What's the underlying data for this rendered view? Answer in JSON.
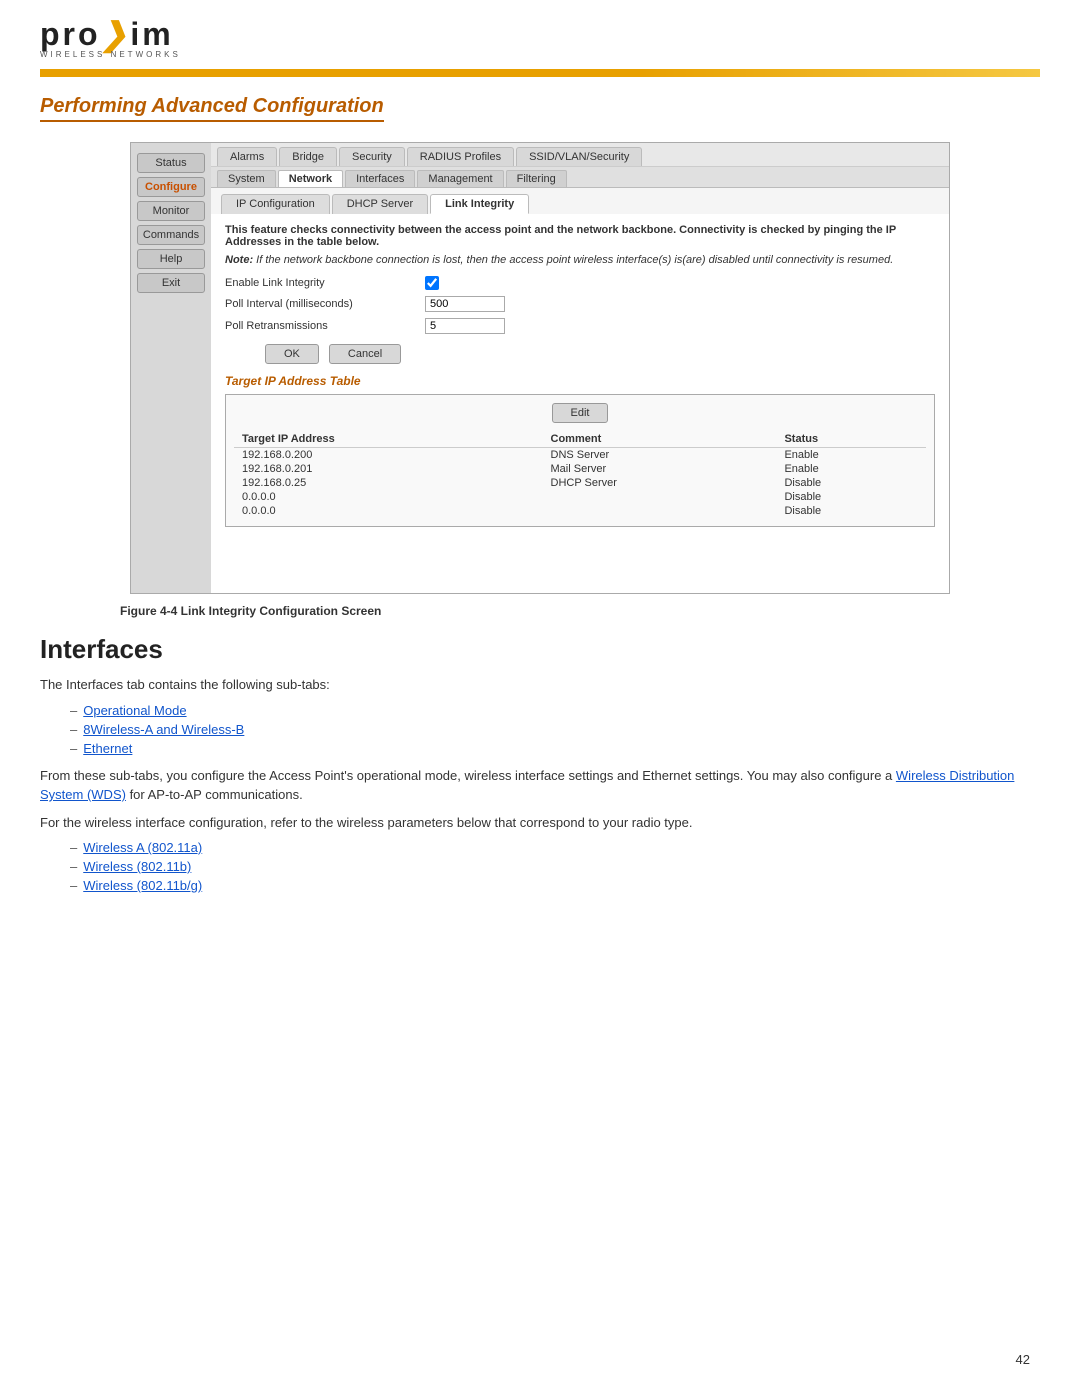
{
  "header": {
    "logo_text_pre": "pro",
    "logo_arrow": "❯",
    "logo_text_post": "im",
    "logo_subtitle": "WIRELESS NETWORKS"
  },
  "page_title": "Performing Advanced Configuration",
  "ui_panel": {
    "sidebar_buttons": [
      {
        "label": "Status",
        "active": false
      },
      {
        "label": "Configure",
        "active": true
      },
      {
        "label": "Monitor",
        "active": false
      },
      {
        "label": "Commands",
        "active": false
      },
      {
        "label": "Help",
        "active": false
      },
      {
        "label": "Exit",
        "active": false
      }
    ],
    "nav_tabs_row1": [
      {
        "label": "Alarms",
        "active": false
      },
      {
        "label": "Bridge",
        "active": false
      },
      {
        "label": "Security",
        "active": false
      },
      {
        "label": "RADIUS Profiles",
        "active": false
      },
      {
        "label": "SSID/VLAN/Security",
        "active": false
      }
    ],
    "nav_tabs_row2": [
      {
        "label": "System",
        "active": false
      },
      {
        "label": "Network",
        "active": true
      },
      {
        "label": "Interfaces",
        "active": false
      },
      {
        "label": "Management",
        "active": false
      },
      {
        "label": "Filtering",
        "active": false
      }
    ],
    "sub_tabs": [
      {
        "label": "IP Configuration",
        "active": false
      },
      {
        "label": "DHCP Server",
        "active": false
      },
      {
        "label": "Link Integrity",
        "active": true
      }
    ],
    "description": "This feature checks connectivity between the access point and the network backbone. Connectivity is checked by pinging the IP Addresses in the table below.",
    "note": "Note: If the network backbone connection is lost, then the access point wireless interface(s) is(are) disabled until connectivity is resumed.",
    "form_fields": [
      {
        "label": "Enable Link Integrity",
        "type": "checkbox",
        "checked": true
      },
      {
        "label": "Poll Interval (milliseconds)",
        "type": "text",
        "value": "500"
      },
      {
        "label": "Poll Retransmissions",
        "type": "text",
        "value": "5"
      }
    ],
    "buttons": [
      {
        "label": "OK"
      },
      {
        "label": "Cancel"
      }
    ],
    "target_table_title": "Target IP Address Table",
    "edit_button": "Edit",
    "table_headers": [
      "Target IP Address",
      "Comment",
      "Status"
    ],
    "table_rows": [
      {
        "ip": "192.168.0.200",
        "comment": "DNS Server",
        "status": "Enable"
      },
      {
        "ip": "192.168.0.201",
        "comment": "Mail Server",
        "status": "Enable"
      },
      {
        "ip": "192.168.0.25",
        "comment": "DHCP Server",
        "status": "Disable"
      },
      {
        "ip": "0.0.0.0",
        "comment": "",
        "status": "Disable"
      },
      {
        "ip": "0.0.0.0",
        "comment": "",
        "status": "Disable"
      }
    ]
  },
  "figure_caption": "Figure 4-4    Link Integrity Configuration Screen",
  "interfaces_section": {
    "heading": "Interfaces",
    "intro_text": "The Interfaces tab contains the following sub-tabs:",
    "sub_tab_links": [
      {
        "label": "Operational Mode"
      },
      {
        "label": "8Wireless-A and Wireless-B"
      },
      {
        "label": "Ethernet"
      }
    ],
    "body_text1": "From these sub-tabs, you configure the Access Point's operational mode, wireless interface settings and Ethernet settings. You may also configure a",
    "wds_link": "Wireless Distribution System (WDS)",
    "body_text1_cont": "for AP-to-AP communications.",
    "body_text2": "For the wireless interface configuration, refer to the wireless parameters below that correspond to your radio type.",
    "radio_links": [
      {
        "label": "Wireless A (802.11a)"
      },
      {
        "label": "Wireless (802.11b)"
      },
      {
        "label": "Wireless (802.11b/g)"
      }
    ]
  },
  "page_number": "42"
}
